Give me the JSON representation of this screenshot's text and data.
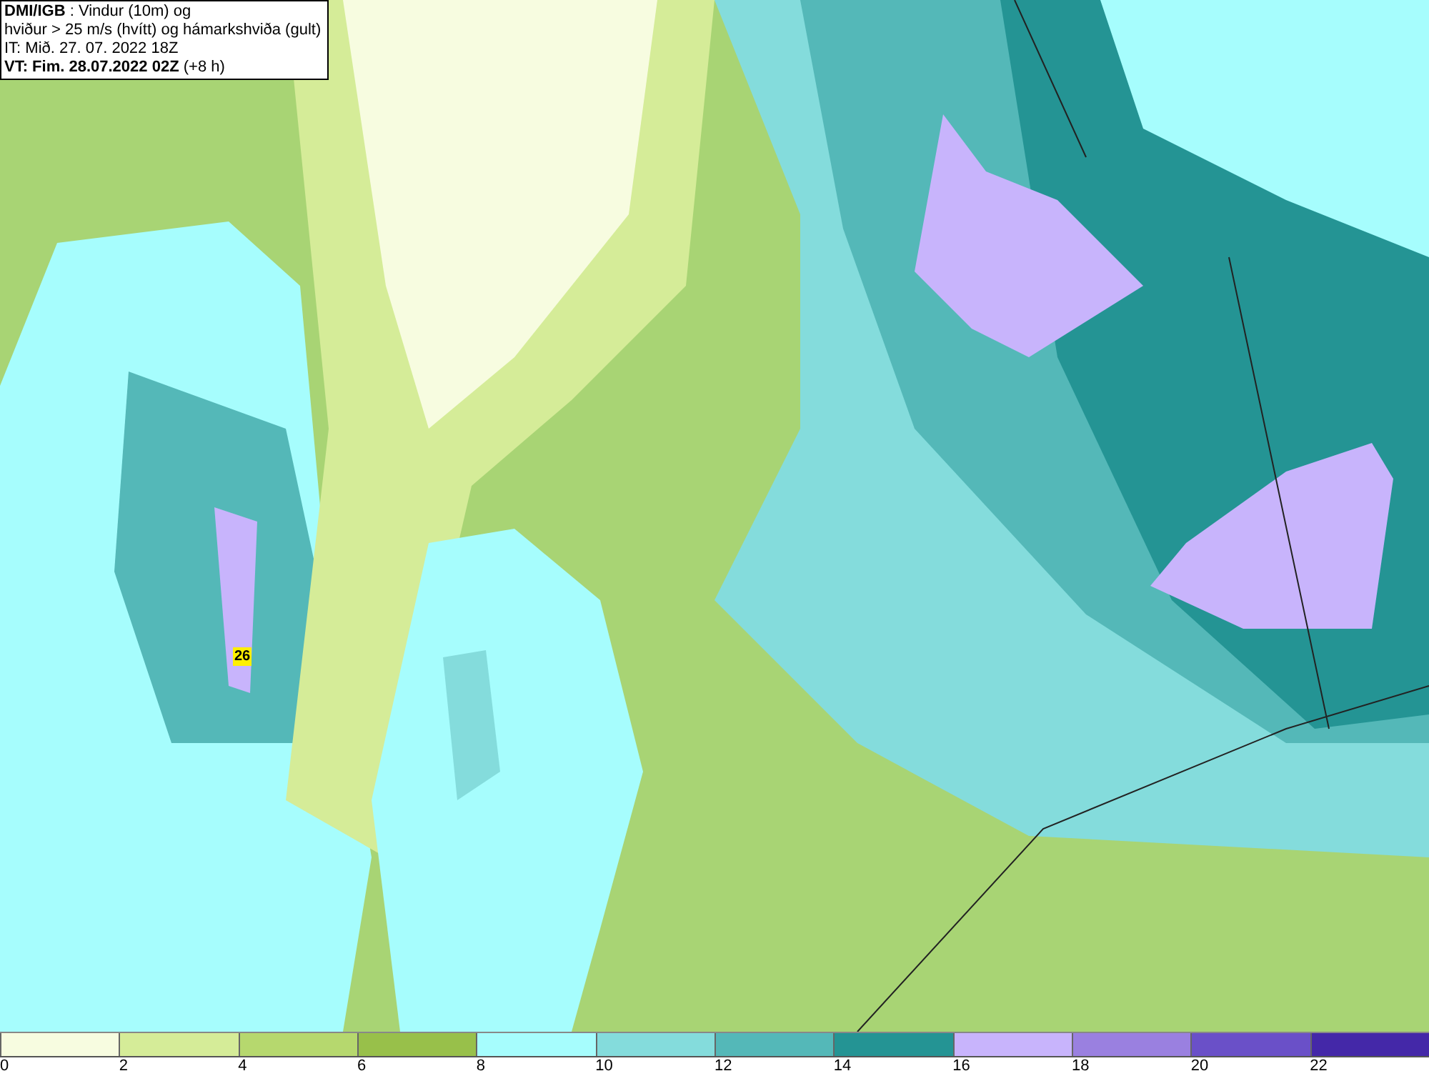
{
  "title": {
    "lines": [
      "**DMI/IGB** : Vindur (10m) og",
      "hviður > 25 m/s (hvítt) og hámarkshviða (gult)",
      "IT: Mið. 27. 07. 2022 18Z",
      "**VT: Fim. 28.07.2022 02Z** (+8 h)"
    ]
  },
  "gust_markers": [
    {
      "value": "26"
    }
  ],
  "legend": {
    "bins": [
      {
        "color": "#f7fce0"
      },
      {
        "color": "#d5ec98"
      },
      {
        "color": "#b6d86e"
      },
      {
        "color": "#98c04a"
      },
      {
        "color": "#a6fdfd"
      },
      {
        "color": "#84dcdc"
      },
      {
        "color": "#54b8b8"
      },
      {
        "color": "#249494"
      },
      {
        "color": "#c8b4fc"
      },
      {
        "color": "#9a80e0"
      },
      {
        "color": "#6a50c8"
      },
      {
        "color": "#4428a8"
      }
    ],
    "ticks": [
      "0",
      "2",
      "4",
      "6",
      "8",
      "10",
      "12",
      "14",
      "16",
      "18",
      "20",
      "22"
    ]
  }
}
